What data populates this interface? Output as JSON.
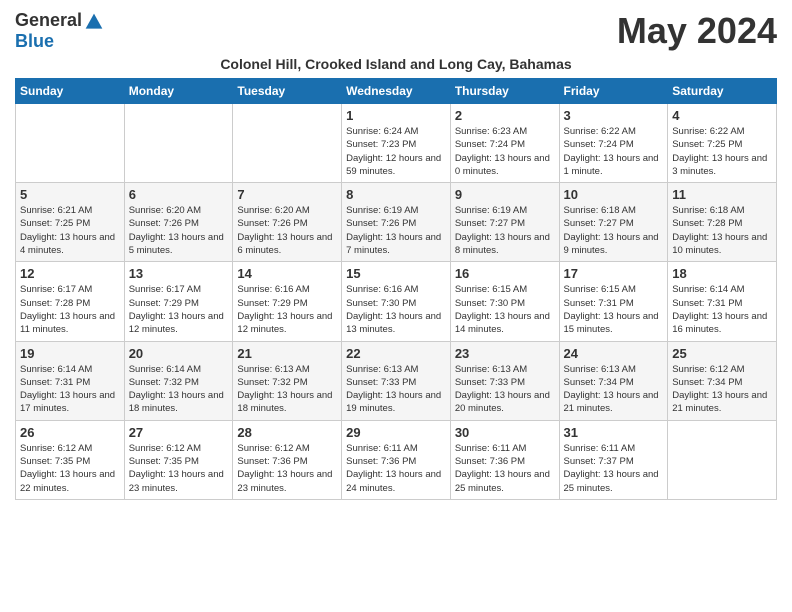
{
  "header": {
    "logo_general": "General",
    "logo_blue": "Blue",
    "month_title": "May 2024",
    "subtitle": "Colonel Hill, Crooked Island and Long Cay, Bahamas"
  },
  "days_of_week": [
    "Sunday",
    "Monday",
    "Tuesday",
    "Wednesday",
    "Thursday",
    "Friday",
    "Saturday"
  ],
  "weeks": [
    [
      {
        "day": "",
        "sunrise": "",
        "sunset": "",
        "daylight": ""
      },
      {
        "day": "",
        "sunrise": "",
        "sunset": "",
        "daylight": ""
      },
      {
        "day": "",
        "sunrise": "",
        "sunset": "",
        "daylight": ""
      },
      {
        "day": "1",
        "sunrise": "Sunrise: 6:24 AM",
        "sunset": "Sunset: 7:23 PM",
        "daylight": "Daylight: 12 hours and 59 minutes."
      },
      {
        "day": "2",
        "sunrise": "Sunrise: 6:23 AM",
        "sunset": "Sunset: 7:24 PM",
        "daylight": "Daylight: 13 hours and 0 minutes."
      },
      {
        "day": "3",
        "sunrise": "Sunrise: 6:22 AM",
        "sunset": "Sunset: 7:24 PM",
        "daylight": "Daylight: 13 hours and 1 minute."
      },
      {
        "day": "4",
        "sunrise": "Sunrise: 6:22 AM",
        "sunset": "Sunset: 7:25 PM",
        "daylight": "Daylight: 13 hours and 3 minutes."
      }
    ],
    [
      {
        "day": "5",
        "sunrise": "Sunrise: 6:21 AM",
        "sunset": "Sunset: 7:25 PM",
        "daylight": "Daylight: 13 hours and 4 minutes."
      },
      {
        "day": "6",
        "sunrise": "Sunrise: 6:20 AM",
        "sunset": "Sunset: 7:26 PM",
        "daylight": "Daylight: 13 hours and 5 minutes."
      },
      {
        "day": "7",
        "sunrise": "Sunrise: 6:20 AM",
        "sunset": "Sunset: 7:26 PM",
        "daylight": "Daylight: 13 hours and 6 minutes."
      },
      {
        "day": "8",
        "sunrise": "Sunrise: 6:19 AM",
        "sunset": "Sunset: 7:26 PM",
        "daylight": "Daylight: 13 hours and 7 minutes."
      },
      {
        "day": "9",
        "sunrise": "Sunrise: 6:19 AM",
        "sunset": "Sunset: 7:27 PM",
        "daylight": "Daylight: 13 hours and 8 minutes."
      },
      {
        "day": "10",
        "sunrise": "Sunrise: 6:18 AM",
        "sunset": "Sunset: 7:27 PM",
        "daylight": "Daylight: 13 hours and 9 minutes."
      },
      {
        "day": "11",
        "sunrise": "Sunrise: 6:18 AM",
        "sunset": "Sunset: 7:28 PM",
        "daylight": "Daylight: 13 hours and 10 minutes."
      }
    ],
    [
      {
        "day": "12",
        "sunrise": "Sunrise: 6:17 AM",
        "sunset": "Sunset: 7:28 PM",
        "daylight": "Daylight: 13 hours and 11 minutes."
      },
      {
        "day": "13",
        "sunrise": "Sunrise: 6:17 AM",
        "sunset": "Sunset: 7:29 PM",
        "daylight": "Daylight: 13 hours and 12 minutes."
      },
      {
        "day": "14",
        "sunrise": "Sunrise: 6:16 AM",
        "sunset": "Sunset: 7:29 PM",
        "daylight": "Daylight: 13 hours and 12 minutes."
      },
      {
        "day": "15",
        "sunrise": "Sunrise: 6:16 AM",
        "sunset": "Sunset: 7:30 PM",
        "daylight": "Daylight: 13 hours and 13 minutes."
      },
      {
        "day": "16",
        "sunrise": "Sunrise: 6:15 AM",
        "sunset": "Sunset: 7:30 PM",
        "daylight": "Daylight: 13 hours and 14 minutes."
      },
      {
        "day": "17",
        "sunrise": "Sunrise: 6:15 AM",
        "sunset": "Sunset: 7:31 PM",
        "daylight": "Daylight: 13 hours and 15 minutes."
      },
      {
        "day": "18",
        "sunrise": "Sunrise: 6:14 AM",
        "sunset": "Sunset: 7:31 PM",
        "daylight": "Daylight: 13 hours and 16 minutes."
      }
    ],
    [
      {
        "day": "19",
        "sunrise": "Sunrise: 6:14 AM",
        "sunset": "Sunset: 7:31 PM",
        "daylight": "Daylight: 13 hours and 17 minutes."
      },
      {
        "day": "20",
        "sunrise": "Sunrise: 6:14 AM",
        "sunset": "Sunset: 7:32 PM",
        "daylight": "Daylight: 13 hours and 18 minutes."
      },
      {
        "day": "21",
        "sunrise": "Sunrise: 6:13 AM",
        "sunset": "Sunset: 7:32 PM",
        "daylight": "Daylight: 13 hours and 18 minutes."
      },
      {
        "day": "22",
        "sunrise": "Sunrise: 6:13 AM",
        "sunset": "Sunset: 7:33 PM",
        "daylight": "Daylight: 13 hours and 19 minutes."
      },
      {
        "day": "23",
        "sunrise": "Sunrise: 6:13 AM",
        "sunset": "Sunset: 7:33 PM",
        "daylight": "Daylight: 13 hours and 20 minutes."
      },
      {
        "day": "24",
        "sunrise": "Sunrise: 6:13 AM",
        "sunset": "Sunset: 7:34 PM",
        "daylight": "Daylight: 13 hours and 21 minutes."
      },
      {
        "day": "25",
        "sunrise": "Sunrise: 6:12 AM",
        "sunset": "Sunset: 7:34 PM",
        "daylight": "Daylight: 13 hours and 21 minutes."
      }
    ],
    [
      {
        "day": "26",
        "sunrise": "Sunrise: 6:12 AM",
        "sunset": "Sunset: 7:35 PM",
        "daylight": "Daylight: 13 hours and 22 minutes."
      },
      {
        "day": "27",
        "sunrise": "Sunrise: 6:12 AM",
        "sunset": "Sunset: 7:35 PM",
        "daylight": "Daylight: 13 hours and 23 minutes."
      },
      {
        "day": "28",
        "sunrise": "Sunrise: 6:12 AM",
        "sunset": "Sunset: 7:36 PM",
        "daylight": "Daylight: 13 hours and 23 minutes."
      },
      {
        "day": "29",
        "sunrise": "Sunrise: 6:11 AM",
        "sunset": "Sunset: 7:36 PM",
        "daylight": "Daylight: 13 hours and 24 minutes."
      },
      {
        "day": "30",
        "sunrise": "Sunrise: 6:11 AM",
        "sunset": "Sunset: 7:36 PM",
        "daylight": "Daylight: 13 hours and 25 minutes."
      },
      {
        "day": "31",
        "sunrise": "Sunrise: 6:11 AM",
        "sunset": "Sunset: 7:37 PM",
        "daylight": "Daylight: 13 hours and 25 minutes."
      },
      {
        "day": "",
        "sunrise": "",
        "sunset": "",
        "daylight": ""
      }
    ]
  ]
}
